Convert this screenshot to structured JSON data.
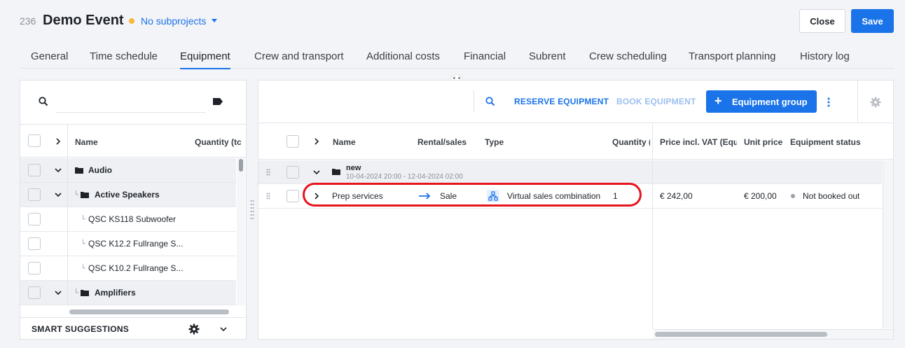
{
  "header": {
    "event_id": "236",
    "event_name": "Demo Event",
    "subprojects_label": "No subprojects",
    "close_label": "Close",
    "save_label": "Save"
  },
  "tabs": [
    {
      "label": "General"
    },
    {
      "label": "Time schedule"
    },
    {
      "label": "Equipment",
      "active": true
    },
    {
      "label": "Crew and transport"
    },
    {
      "label": "Additional costs"
    },
    {
      "label": "Financial"
    },
    {
      "label": "Subrent"
    },
    {
      "label": "Crew scheduling"
    },
    {
      "label": "Transport planning"
    },
    {
      "label": "History log"
    }
  ],
  "left_panel": {
    "search_placeholder": "",
    "columns": {
      "name": "Name",
      "quantity": "Quantity (tc"
    },
    "rows": [
      {
        "label": "Audio",
        "type": "folder"
      },
      {
        "label": "Active Speakers",
        "type": "folder"
      },
      {
        "label": "QSC KS118 Subwoofer",
        "type": "item"
      },
      {
        "label": "QSC K12.2 Fullrange S...",
        "type": "item"
      },
      {
        "label": "QSC K10.2 Fullrange S...",
        "type": "item"
      },
      {
        "label": "Amplifiers",
        "type": "folder"
      }
    ],
    "smart_suggestions_label": "SMART SUGGESTIONS"
  },
  "right_panel": {
    "toolbar": {
      "reserve_label": "RESERVE EQUIPMENT",
      "book_label": "BOOK EQUIPMENT",
      "group_button_label": "Equipment group"
    },
    "columns": {
      "name": "Name",
      "rental": "Rental/sales",
      "type": "Type",
      "quantity": "Quantity (",
      "price_vat": "Price incl. VAT (Equi",
      "unit_price": "Unit price",
      "status": "Equipment status"
    },
    "group_row": {
      "name": "new",
      "date_range": "10-04-2024 20:00 - 12-04-2024 02:00"
    },
    "item_row": {
      "name": "Prep services",
      "rental": "Sale",
      "type": "Virtual sales combination",
      "quantity": "1",
      "price_vat": "€ 242,00",
      "unit_price": "€ 200,00",
      "status": "Not booked out"
    }
  },
  "colors": {
    "accent": "#1a73e8",
    "status_dot": "#f6b73c",
    "highlight": "#e8141c"
  }
}
